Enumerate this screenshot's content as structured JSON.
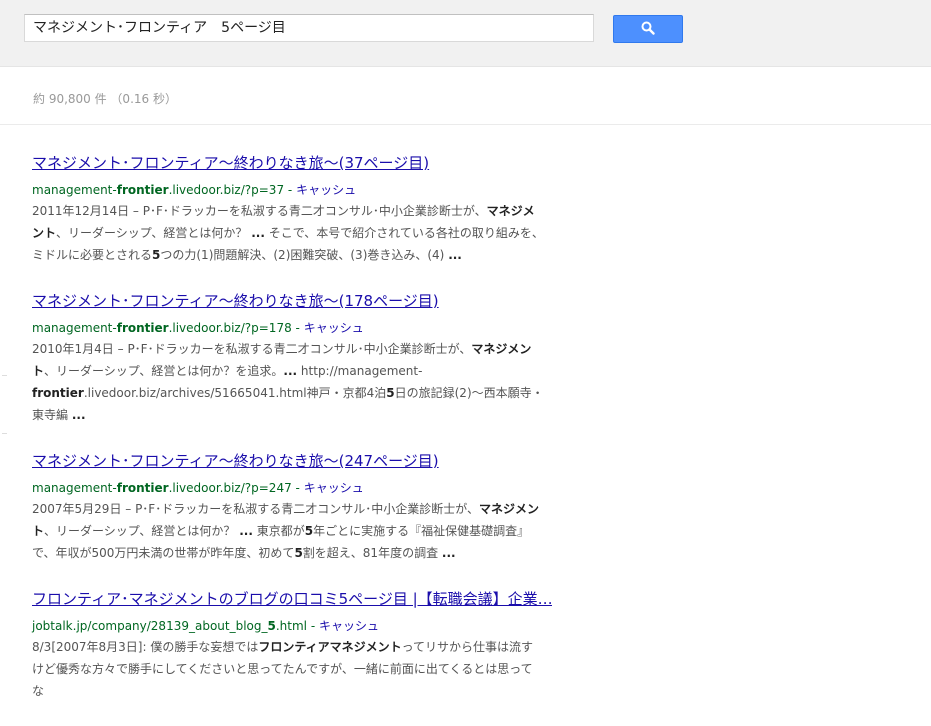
{
  "search": {
    "query": "マネジメント･フロンティア　5ページ目"
  },
  "stats": "約 90,800 件 （0.16 秒）",
  "results": [
    {
      "title": "マネジメント･フロンティア～終わりなき旅～(37ページ目)",
      "url_prefix": "management-",
      "url_bold": "frontier",
      "url_suffix": ".livedoor.biz/?p=37",
      "cache": "キャッシュ",
      "snippet_html": "2011年12月14日 – P･F･ドラッカーを私淑する青二才コンサル･中小企業診断士が、<b>マネジメント</b>、リーダーシップ、経営とは何か？ <b>...</b> そこで、本号で紹介されている各社の取り組みを、ミドルに必要とされる<b>5</b>つの力(1)問題解決、(2)困難突破、(3)巻き込み、(4) <b>...</b>"
    },
    {
      "title": "マネジメント･フロンティア～終わりなき旅～(178ページ目)",
      "url_prefix": "management-",
      "url_bold": "frontier",
      "url_suffix": ".livedoor.biz/?p=178",
      "cache": "キャッシュ",
      "snippet_html": "2010年1月4日 – P･F･ドラッカーを私淑する青二才コンサル･中小企業診断士が、<b>マネジメント</b>、リーダーシップ、経営とは何か？を追求。<b>...</b> http://management-<b>frontier</b>.livedoor.biz/archives/51665041.html神戸・京都4泊<b>5</b>日の旅記録(2)～西本願寺・東寺編 <b>...</b>"
    },
    {
      "title": "マネジメント･フロンティア～終わりなき旅～(247ページ目)",
      "url_prefix": "management-",
      "url_bold": "frontier",
      "url_suffix": ".livedoor.biz/?p=247",
      "cache": "キャッシュ",
      "snippet_html": "2007年5月29日 – P･F･ドラッカーを私淑する青二才コンサル･中小企業診断士が、<b>マネジメント</b>、リーダーシップ、経営とは何か？ <b>...</b> 東京都が<b>5</b>年ごとに実施する『福祉保健基礎調査』で、年収が500万円未満の世帯が昨年度、初めて<b>5</b>割を超え、81年度の調査 <b>...</b>"
    },
    {
      "title": "フロンティア･マネジメントのブログの口コミ5ページ目 |【転職会議】企業…",
      "url_prefix": "jobtalk.jp/company/28139_about_blog_",
      "url_bold": "5",
      "url_suffix": ".html",
      "cache": "キャッシュ",
      "snippet_html": "8/3[2007年8月3日]: 僕の勝手な妄想では<b>フロンティアマネジメント</b>ってリサから仕事は流すけど優秀な方々で勝手にしてくださいと思ってたんですが、一緒に前面に出てくるとは思ってな"
    }
  ],
  "colors": {
    "title_link": "#1a0dab",
    "url_green": "#006621",
    "button_blue": "#4d90fe"
  }
}
